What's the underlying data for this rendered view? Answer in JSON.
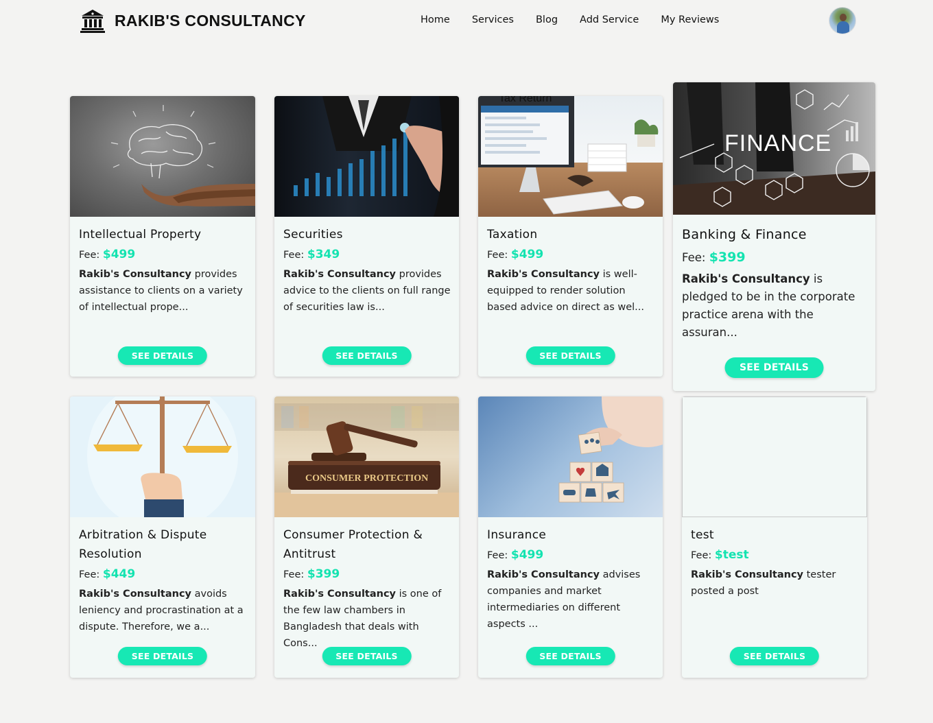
{
  "header": {
    "brand": "RAKIB'S CONSULTANCY",
    "nav": [
      "Home",
      "Services",
      "Blog",
      "Add Service",
      "My Reviews"
    ]
  },
  "colors": {
    "accent": "#17e8b4",
    "fee": "#14e3b0",
    "card_bg": "#f2f8f6",
    "page_bg": "#f3f3f2"
  },
  "services": [
    {
      "title": "Intellectual Property",
      "fee_label": "Fee:",
      "fee": "$499",
      "company": "Rakib's Consultancy",
      "desc": " provides assistance to clients on a variety of intellectual prope...",
      "button": "See details",
      "image": "brain-in-hand"
    },
    {
      "title": "Securities",
      "fee_label": "Fee:",
      "fee": "$349",
      "company": "Rakib's Consultancy",
      "desc": " provides advice to the clients on full range of securities law is...",
      "button": "See details",
      "image": "business-chart"
    },
    {
      "title": "Taxation",
      "fee_label": "Fee:",
      "fee": "$499",
      "company": "Rakib's Consultancy",
      "desc": " is well-equipped to render solution based advice on direct as wel...",
      "button": "See details",
      "image": "tax-return-desk",
      "image_text": "Tax Return"
    },
    {
      "title": "Banking & Finance",
      "fee_label": "Fee:",
      "fee": "$399",
      "company": "Rakib's Consultancy",
      "desc": " is pledged to be in the corporate practice arena with the assuran...",
      "button": "See details",
      "image": "finance-graphic",
      "image_text": "FINANCE"
    },
    {
      "title": "Arbitration & Dispute Resolution",
      "fee_label": "Fee:",
      "fee": "$449",
      "company": "Rakib's Consultancy",
      "desc": " avoids leniency and procrastination at a dispute. Therefore, we a...",
      "button": "See details",
      "image": "justice-scale"
    },
    {
      "title": "Consumer Protection & Antitrust",
      "fee_label": "Fee:",
      "fee": "$399",
      "company": "Rakib's Consultancy",
      "desc": " is one of the few law chambers in Bangladesh that deals with Cons...",
      "button": "See details",
      "image": "gavel-book",
      "image_text": "CONSUMER PROTECTION"
    },
    {
      "title": "Insurance",
      "fee_label": "Fee:",
      "fee": "$499",
      "company": "Rakib's Consultancy",
      "desc": " advises companies and market intermediaries on different aspects ...",
      "button": "See details",
      "image": "insurance-blocks"
    },
    {
      "title": "test",
      "fee_label": "Fee:",
      "fee": "$test",
      "company": "Rakib's Consultancy",
      "desc": " tester posted a post",
      "button": "See details",
      "image": "broken-image"
    }
  ]
}
